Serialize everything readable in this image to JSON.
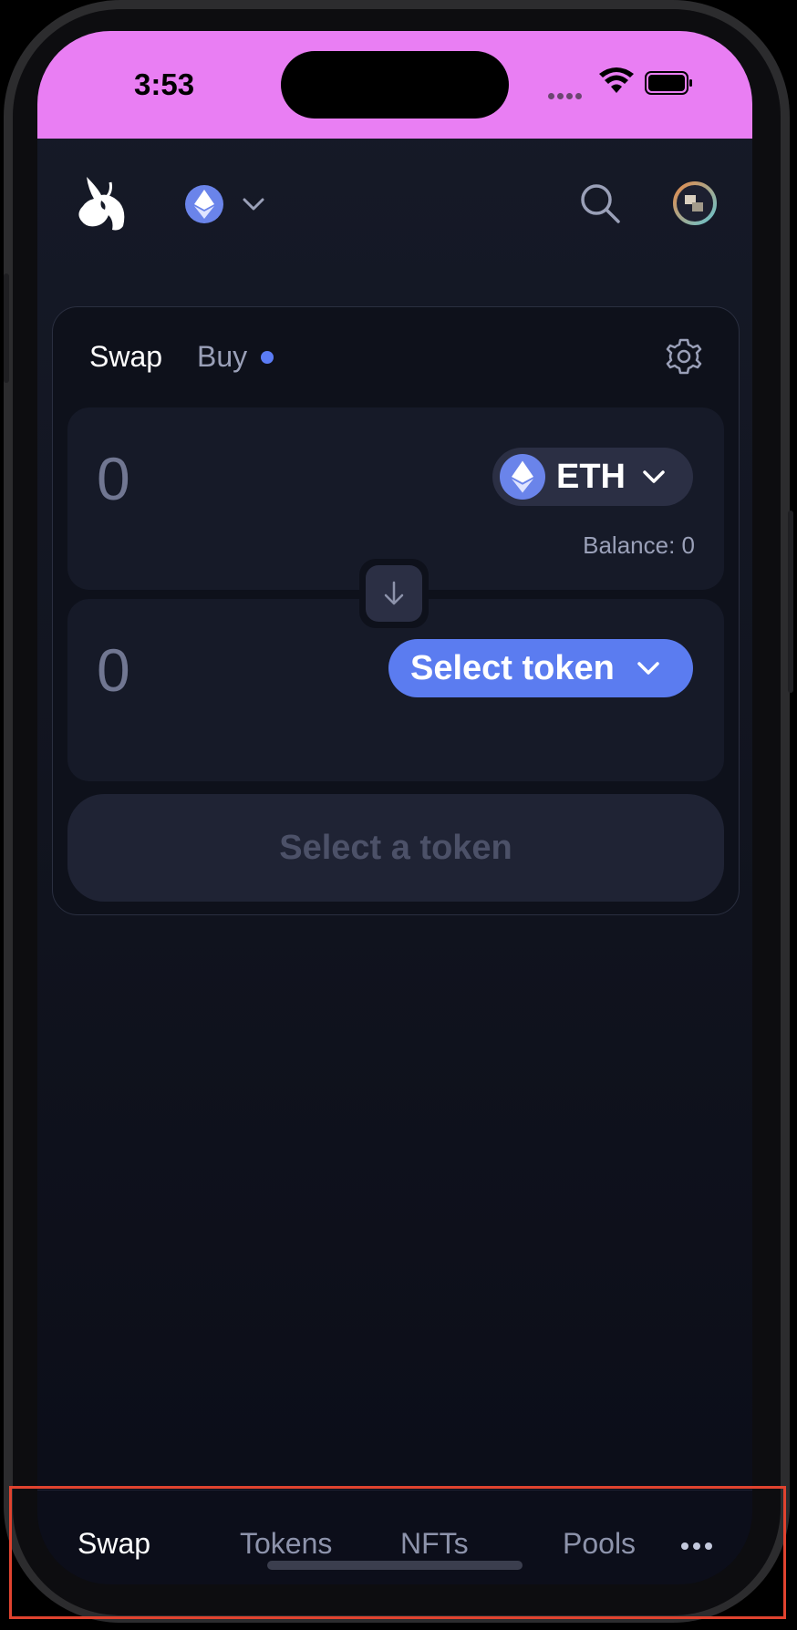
{
  "status_bar": {
    "time": "3:53"
  },
  "header": {
    "network": "ETH"
  },
  "swap_card": {
    "tabs": [
      {
        "label": "Swap",
        "active": true
      },
      {
        "label": "Buy",
        "badge": "dot"
      }
    ],
    "from": {
      "amount": "0",
      "token": "ETH",
      "balance": "Balance: 0"
    },
    "to": {
      "amount": "0",
      "select_label": "Select token"
    },
    "action_label": "Select a token"
  },
  "bottom_nav": {
    "items": [
      {
        "label": "Swap",
        "active": true
      },
      {
        "label": "Tokens"
      },
      {
        "label": "NFTs"
      },
      {
        "label": "Pools"
      }
    ],
    "more_icon": "more-dots-icon"
  },
  "colors": {
    "status_bar_bg": "#e97ef3",
    "accent": "#5b7cf0",
    "background": "#11141f"
  }
}
